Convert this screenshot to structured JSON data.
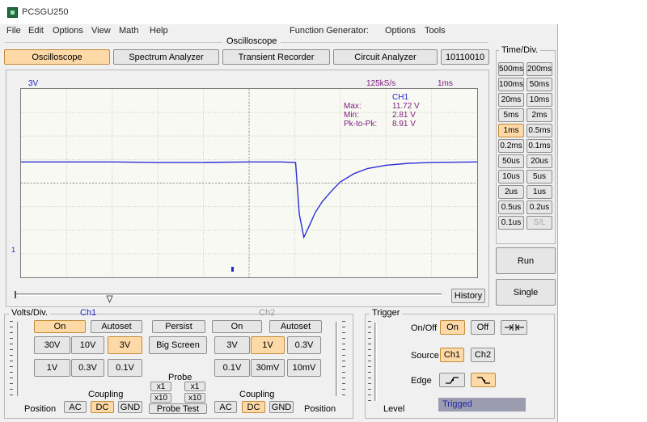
{
  "app": {
    "title": "PCSGU250"
  },
  "menu": {
    "file": "File",
    "edit": "Edit",
    "options": "Options",
    "view": "View",
    "math": "Math",
    "help": "Help",
    "fg": "Function Generator:",
    "fg_options": "Options",
    "tools": "Tools"
  },
  "section": {
    "oscilloscope": "Oscilloscope"
  },
  "modes": {
    "oscilloscope": "Oscilloscope",
    "spectrum": "Spectrum Analyzer",
    "transient": "Transient Recorder",
    "circuit": "Circuit Analyzer",
    "code": "10110010"
  },
  "scope": {
    "volt_label": "3V",
    "rate": "125kS/s",
    "timebase": "1ms",
    "readout": {
      "ch": "CH1",
      "max_label": "Max:",
      "max": "11.72 V",
      "min_label": "Min:",
      "min": "2.81 V",
      "pp_label": "Pk-to-Pk:",
      "pp": "8.91 V"
    },
    "marker": "1",
    "history": "History"
  },
  "timediv": {
    "title": "Time/Div.",
    "rows": [
      [
        "500ms",
        "200ms"
      ],
      [
        "100ms",
        "50ms"
      ],
      [
        "20ms",
        "10ms"
      ],
      [
        "5ms",
        "2ms"
      ],
      [
        "1ms",
        "0.5ms"
      ],
      [
        "0.2ms",
        "0.1ms"
      ],
      [
        "50us",
        "20us"
      ],
      [
        "10us",
        "5us"
      ],
      [
        "2us",
        "1us"
      ],
      [
        "0.5us",
        "0.2us"
      ],
      [
        "0.1us",
        "S/L"
      ]
    ],
    "selected": "1ms",
    "disabled": "S/L"
  },
  "run": "Run",
  "single": "Single",
  "volts": {
    "title": "Volts/Div.",
    "ch1": {
      "title": "Ch1",
      "on": "On",
      "autoset": "Autoset",
      "v30": "30V",
      "v10": "10V",
      "v3": "3V",
      "v1": "1V",
      "v03": "0.3V",
      "v01": "0.1V"
    },
    "persist": "Persist",
    "big_screen": "Big Screen",
    "probe": {
      "title": "Probe",
      "x1": "x1",
      "x10": "x10",
      "test": "Probe Test"
    },
    "ch2": {
      "title": "Ch2",
      "on": "On",
      "autoset": "Autoset",
      "v3": "3V",
      "v1": "1V",
      "v03": "0.3V",
      "v01": "0.1V",
      "v30m": "30mV",
      "v10m": "10mV"
    },
    "coupling": "Coupling",
    "ac": "AC",
    "dc": "DC",
    "gnd": "GND",
    "position": "Position"
  },
  "trigger": {
    "title": "Trigger",
    "onoff": "On/Off",
    "on": "On",
    "off": "Off",
    "source": "Source",
    "ch1": "Ch1",
    "ch2": "Ch2",
    "edge": "Edge",
    "level": "Level",
    "status": "Trigged"
  },
  "colors": {
    "trace": "#2a2fd6",
    "active": "#fcd9a6",
    "readout": "#7c1a7c",
    "ch1": "#1e27c8",
    "ch2": "#9a9a9a"
  },
  "chart_data": {
    "type": "line",
    "xlim": [
      0,
      10
    ],
    "ylim": [
      -4,
      4
    ],
    "series": [
      {
        "values": [
          [
            0,
            0.9
          ],
          [
            1,
            0.9
          ],
          [
            2,
            0.9
          ],
          [
            3,
            0.88
          ],
          [
            4,
            0.88
          ],
          [
            5,
            0.9
          ],
          [
            5.7,
            0.9
          ],
          [
            6.02,
            0.88
          ],
          [
            6.1,
            -1.3
          ],
          [
            6.2,
            -2.3
          ],
          [
            6.3,
            -1.9
          ],
          [
            6.45,
            -1.25
          ],
          [
            6.6,
            -0.8
          ],
          [
            6.8,
            -0.35
          ],
          [
            7.0,
            0.05
          ],
          [
            7.3,
            0.4
          ],
          [
            7.6,
            0.62
          ],
          [
            8.0,
            0.76
          ],
          [
            8.5,
            0.84
          ],
          [
            9.0,
            0.88
          ],
          [
            10,
            0.9
          ]
        ]
      }
    ]
  }
}
